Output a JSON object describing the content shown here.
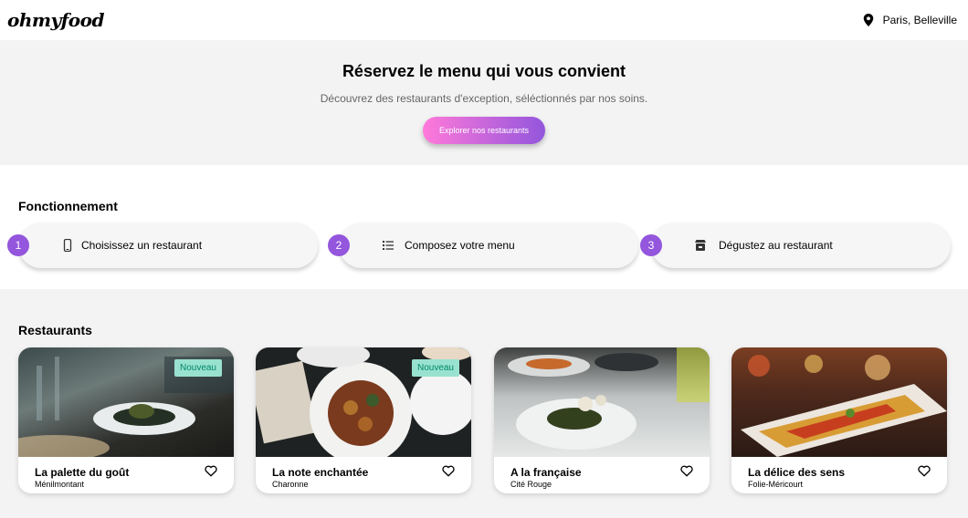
{
  "header": {
    "logo": "ohmyfood",
    "location": "Paris, Belleville",
    "location_icon": "map-pin-icon"
  },
  "hero": {
    "title": "Réservez le menu qui vous convient",
    "subtitle": "Découvrez des restaurants d'exception, séléctionnés par nos soins.",
    "cta": "Explorer nos restaurants"
  },
  "how": {
    "title": "Fonctionnement",
    "steps": [
      {
        "number": "1",
        "label": "Choisissez un restaurant",
        "icon": "mobile-phone-icon"
      },
      {
        "number": "2",
        "label": "Composez votre menu",
        "icon": "list-icon"
      },
      {
        "number": "3",
        "label": "Dégustez au restaurant",
        "icon": "store-icon"
      }
    ]
  },
  "restaurants": {
    "title": "Restaurants",
    "items": [
      {
        "name": "La palette du goût",
        "area": "Ménilmontant",
        "badge": "Nouveau"
      },
      {
        "name": "La note enchantée",
        "area": "Charonne",
        "badge": "Nouveau"
      },
      {
        "name": "A la française",
        "area": "Cité Rouge"
      },
      {
        "name": "La délice des sens",
        "area": "Folie-Méricourt"
      }
    ]
  },
  "colors": {
    "primary": "#9356dc",
    "secondary": "#ff79da",
    "tertiary": "#99e2d0"
  }
}
